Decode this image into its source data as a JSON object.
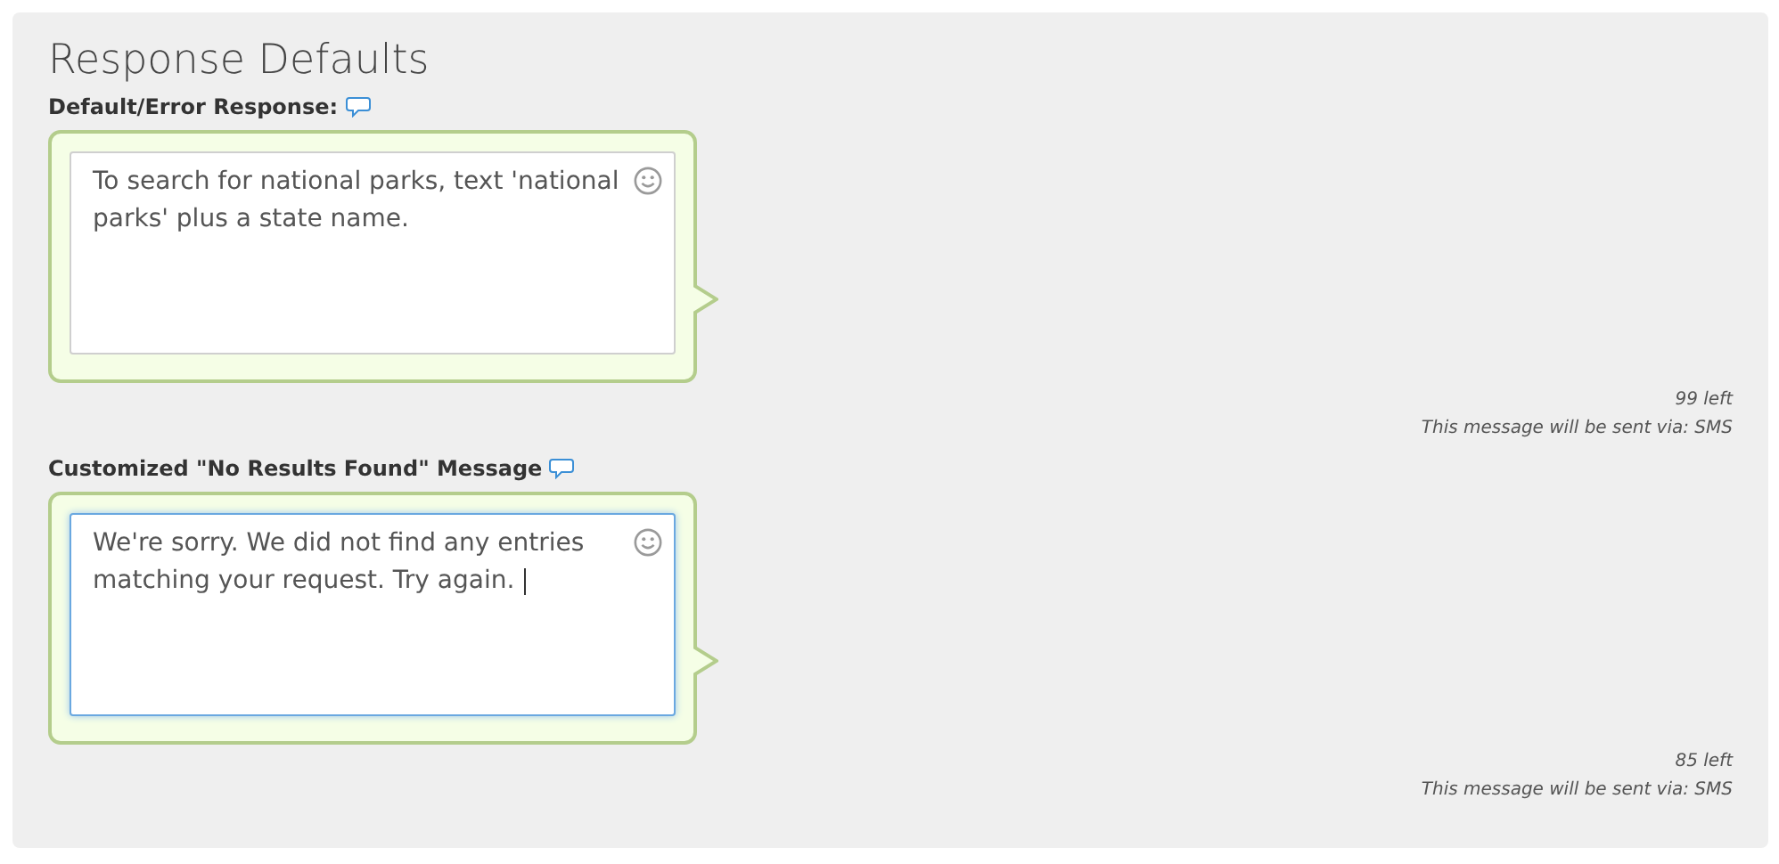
{
  "title": "Response Defaults",
  "fields": [
    {
      "label": "Default/Error Response:",
      "value": "To search for national parks, text 'national parks' plus a state name.",
      "focused": false,
      "remaining": "99 left",
      "channel_note": "This message will be sent via: SMS"
    },
    {
      "label": "Customized \"No Results Found\" Message",
      "value": "We're sorry. We did not find any entries matching your request. Try again.",
      "focused": true,
      "remaining": "85 left",
      "channel_note": "This message will be sent via: SMS"
    }
  ]
}
